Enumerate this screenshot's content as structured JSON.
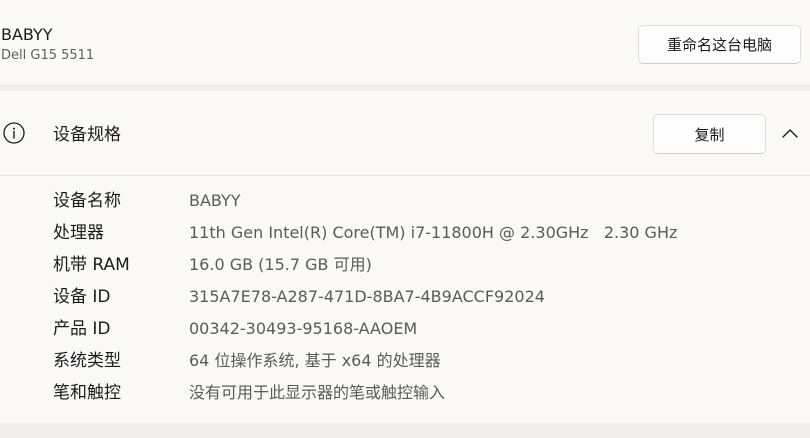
{
  "device": {
    "name": "BABYY",
    "model": "Dell G15 5511",
    "rename_label": "重命名这台电脑"
  },
  "specs_section": {
    "title": "设备规格",
    "copy_label": "复制",
    "icon": "info-icon",
    "collapse_icon": "chevron-up-icon",
    "rows": [
      {
        "label": "设备名称",
        "value": "BABYY"
      },
      {
        "label": "处理器",
        "value": "11th Gen Intel(R) Core(TM) i7-11800H @ 2.30GHz   2.30 GHz"
      },
      {
        "label": "机带 RAM",
        "value": "16.0 GB (15.7 GB 可用)"
      },
      {
        "label": "设备 ID",
        "value": "315A7E78-A287-471D-8BA7-4B9ACCF92024"
      },
      {
        "label": "产品 ID",
        "value": "00342-30493-95168-AAOEM"
      },
      {
        "label": "系统类型",
        "value": "64 位操作系统, 基于 x64 的处理器"
      },
      {
        "label": "笔和触控",
        "value": "没有可用于此显示器的笔或触控输入"
      }
    ]
  }
}
